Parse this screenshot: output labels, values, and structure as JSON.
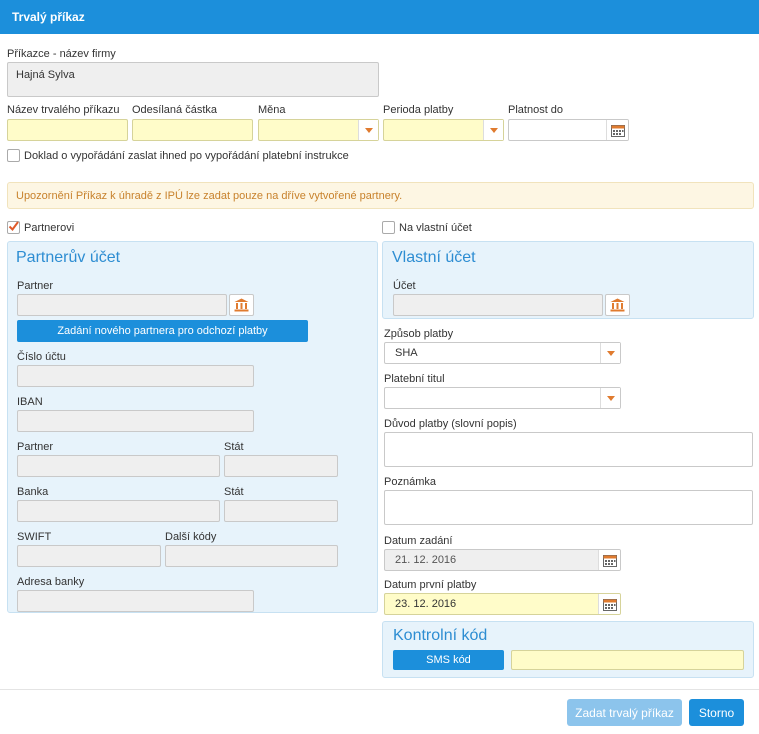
{
  "dialog": {
    "title": "Trvalý příkaz"
  },
  "form": {
    "payer_label": "Příkazce - název firmy",
    "payer_value": "Hajná Sylva",
    "order_name_label": "Název trvalého příkazu",
    "amount_label": "Odesílaná částka",
    "currency_label": "Měna",
    "period_label": "Perioda platby",
    "valid_to_label": "Platnost do",
    "confirmation_label": "Doklad o vypořádání zaslat ihned po vypořádání platební instrukce"
  },
  "warning": "Upozornění Příkaz k úhradě z IPÚ lze zadat pouze na dříve vytvořené partnery.",
  "options": {
    "partner_label": "Partnerovi",
    "partner_checked": true,
    "own_label": "Na vlastní účet",
    "own_checked": false
  },
  "partner_panel": {
    "title": "Partnerův účet",
    "partner_label": "Partner",
    "new_partner_button": "Zadání nového partnera pro odchozí platby",
    "account_label": "Číslo účtu",
    "iban_label": "IBAN",
    "partner2_label": "Partner",
    "state_label": "Stát",
    "bank_label": "Banka",
    "state2_label": "Stát",
    "swift_label": "SWIFT",
    "other_codes_label": "Další kódy",
    "bank_address_label": "Adresa banky"
  },
  "own_panel": {
    "title": "Vlastní účet",
    "account_label": "Účet"
  },
  "payment": {
    "method_label": "Způsob platby",
    "method_value": "SHA",
    "title_label": "Platební titul",
    "reason_label": "Důvod platby (slovní popis)",
    "note_label": "Poznámka",
    "entry_date_label": "Datum zadání",
    "entry_date_value": "21. 12. 2016",
    "first_date_label": "Datum první platby",
    "first_date_value": "23. 12. 2016"
  },
  "control": {
    "title": "Kontrolní kód",
    "sms_button": "SMS kód"
  },
  "footer": {
    "submit_button": "Zadat trvalý příkaz",
    "cancel_button": "Storno"
  },
  "icons": {
    "calendar": "calendar-icon",
    "bank": "bank-icon",
    "dropdown": "chevron-down-icon",
    "checkmark": "checkmark-icon"
  },
  "colors": {
    "accent": "#1c8fdb",
    "required_field": "#fffcc9",
    "warning_text": "#c8822c",
    "panel_bg": "#e7f3fb"
  }
}
